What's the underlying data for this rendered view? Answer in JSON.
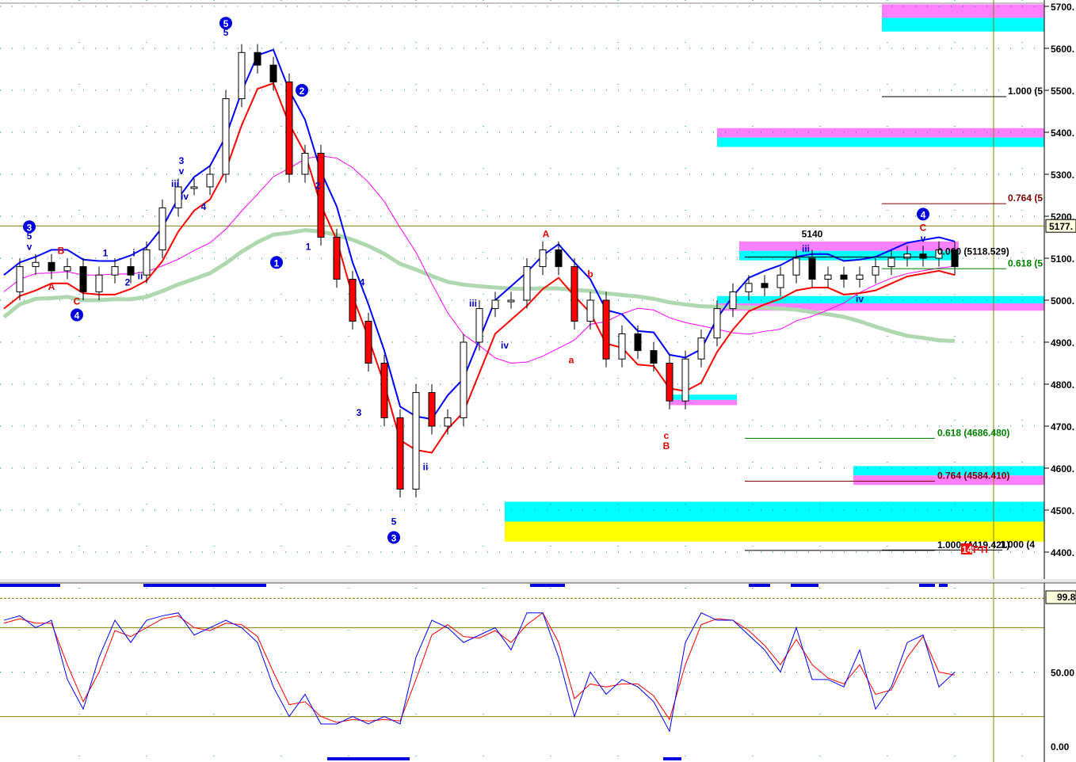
{
  "chart_data": {
    "type": "line",
    "title": "",
    "price_axis": {
      "ticks": [
        5700,
        5600,
        5500,
        5400,
        5300,
        5200,
        5100,
        5000,
        4900,
        4800,
        4700,
        4600,
        4500,
        4400
      ],
      "tick_suffix": ".",
      "ylim": [
        4380,
        5710
      ],
      "current_price_label": "5177."
    },
    "osc_axis": {
      "ticks": [
        {
          "v": 50,
          "label": "50.00"
        },
        {
          "v": 0,
          "label": "0.00"
        }
      ],
      "top_label": "99.8",
      "levels": [
        80,
        20
      ],
      "ylim": [
        0,
        100
      ]
    },
    "x": [
      0,
      1,
      2,
      3,
      4,
      5,
      6,
      7,
      8,
      9,
      10,
      11,
      12,
      13,
      14,
      15,
      16,
      17,
      18,
      19,
      20,
      21,
      22,
      23,
      24,
      25,
      26,
      27,
      28,
      29,
      30,
      31,
      32,
      33,
      34,
      35,
      36,
      37,
      38,
      39,
      40,
      41,
      42,
      43,
      44,
      45,
      46,
      47,
      48,
      49,
      50,
      51,
      52,
      53,
      54,
      55,
      56,
      57,
      58,
      59,
      60
    ],
    "series": [
      {
        "name": "price",
        "color": "#000000",
        "values": [
          5020,
          5080,
          5090,
          5070,
          5080,
          5020,
          5060,
          5080,
          5060,
          5120,
          5220,
          5270,
          5270,
          5300,
          5480,
          5590,
          5560,
          5520,
          5300,
          5350,
          5150,
          5050,
          4950,
          4850,
          4720,
          4550,
          4780,
          4700,
          4720,
          4900,
          4980,
          5000,
          5000,
          5080,
          5120,
          5080,
          4950,
          5000,
          4860,
          4920,
          4880,
          4850,
          4760,
          4860,
          4910,
          4980,
          5020,
          5040,
          5030,
          5060,
          5100,
          5050,
          5060,
          5050,
          5060,
          5080,
          5100,
          5110,
          5100,
          5120,
          5080
        ]
      },
      {
        "name": "stoch_k",
        "color": "#0000ff",
        "values": [
          85,
          88,
          80,
          85,
          45,
          25,
          60,
          85,
          70,
          85,
          88,
          90,
          75,
          80,
          85,
          80,
          70,
          40,
          20,
          35,
          15,
          15,
          20,
          15,
          20,
          15,
          60,
          85,
          80,
          70,
          75,
          80,
          65,
          90,
          90,
          60,
          20,
          50,
          35,
          45,
          40,
          30,
          10,
          70,
          90,
          85,
          85,
          75,
          65,
          50,
          80,
          45,
          45,
          40,
          65,
          25,
          40,
          70,
          75,
          40,
          50
        ]
      },
      {
        "name": "stoch_d",
        "color": "#ff0000",
        "values": [
          83,
          86,
          83,
          83,
          55,
          30,
          50,
          78,
          74,
          80,
          86,
          88,
          80,
          78,
          83,
          82,
          74,
          50,
          28,
          30,
          20,
          16,
          18,
          17,
          18,
          17,
          45,
          75,
          82,
          74,
          73,
          78,
          70,
          82,
          90,
          70,
          32,
          42,
          40,
          42,
          42,
          34,
          18,
          55,
          82,
          86,
          85,
          78,
          68,
          55,
          72,
          55,
          46,
          42,
          55,
          35,
          38,
          60,
          74,
          50,
          48
        ]
      }
    ],
    "zones": [
      {
        "name": "zone-5700",
        "low": 5640,
        "high": 5705,
        "colors": [
          "#ff80ff",
          "#00ffff"
        ]
      },
      {
        "name": "zone-5400",
        "low": 5365,
        "high": 5410,
        "colors": [
          "#ff80ff",
          "#00ffff"
        ]
      },
      {
        "name": "zone-5120",
        "low": 5095,
        "high": 5140,
        "colors": [
          "#ff80ff",
          "#00ffff"
        ]
      },
      {
        "name": "zone-5000",
        "low": 4975,
        "high": 5010,
        "colors": [
          "#00ffff",
          "#ff80ff"
        ]
      },
      {
        "name": "zone-4600",
        "low": 4560,
        "high": 4605,
        "colors": [
          "#00ffff",
          "#ff80ff"
        ]
      },
      {
        "name": "zone-4500",
        "low": 4425,
        "high": 4520,
        "colors": [
          "#00ffff",
          "#ffff00"
        ]
      },
      {
        "name": "zone-4760",
        "low": 4750,
        "high": 4775,
        "colors": [
          "#00ffff",
          "#ff80ff"
        ]
      }
    ],
    "fib_labels": [
      {
        "text": "1.000 (5",
        "price": 5500,
        "color": "#000000"
      },
      {
        "text": "0.764 (5",
        "price": 5245,
        "color": "#800000"
      },
      {
        "text": "0.000 (5118.529)",
        "price": 5118,
        "color": "#000000"
      },
      {
        "text": "0.618 (5",
        "price": 5090,
        "color": "#008000"
      },
      {
        "text": "0.618 (4686.480)",
        "price": 4686,
        "color": "#008000"
      },
      {
        "text": "0.764 (4584.410)",
        "price": 4584,
        "color": "#800000"
      },
      {
        "text": "1.000 (4419.421)",
        "price": 4419,
        "color": "#000000"
      },
      {
        "text": "1.000 (4",
        "price": 4420,
        "color": "#000000"
      }
    ],
    "wave_labels": [
      {
        "text": "5",
        "x": 14,
        "price": 5660,
        "color": "#0000c0",
        "circle": true
      },
      {
        "text": "5",
        "x": 14,
        "price": 5630,
        "color": "#0000c0"
      },
      {
        "text": "2",
        "x": 18.8,
        "price": 5500,
        "color": "#0000c0",
        "circle": true
      },
      {
        "text": "1",
        "x": 17.2,
        "price": 5090,
        "color": "#0000c0",
        "circle": true
      },
      {
        "text": "3",
        "x": 1.6,
        "price": 5175,
        "color": "#0000c0",
        "circle": true
      },
      {
        "text": "4",
        "x": 4.6,
        "price": 4965,
        "color": "#0000c0",
        "circle": true
      },
      {
        "text": "3",
        "x": 24.6,
        "price": 4435,
        "color": "#0000c0",
        "circle": true
      },
      {
        "text": "5",
        "x": 24.6,
        "price": 4465,
        "color": "#0000c0"
      },
      {
        "text": "4",
        "x": 58,
        "price": 5205,
        "color": "#0000c0",
        "circle": true
      },
      {
        "text": "A",
        "x": 3,
        "price": 5025,
        "color": "#e00000"
      },
      {
        "text": "B",
        "x": 3.6,
        "price": 5110,
        "color": "#e00000"
      },
      {
        "text": "C",
        "x": 4.6,
        "price": 4990,
        "color": "#e00000"
      },
      {
        "text": "A",
        "x": 34.2,
        "price": 5150,
        "color": "#e00000"
      },
      {
        "text": "a",
        "x": 35.8,
        "price": 4850,
        "color": "#e00000"
      },
      {
        "text": "b",
        "x": 37,
        "price": 5055,
        "color": "#e00000"
      },
      {
        "text": "c",
        "x": 41.8,
        "price": 4670,
        "color": "#e00000"
      },
      {
        "text": "B",
        "x": 41.8,
        "price": 4645,
        "color": "#e00000"
      },
      {
        "text": "C",
        "x": 58,
        "price": 5165,
        "color": "#e00000"
      },
      {
        "text": "v",
        "x": 58,
        "price": 5140,
        "color": "#0000c0"
      },
      {
        "text": "iii",
        "x": 29.6,
        "price": 4985,
        "color": "#0000c0"
      },
      {
        "text": "iv",
        "x": 31.6,
        "price": 4885,
        "color": "#0000c0"
      },
      {
        "text": "ii",
        "x": 26.6,
        "price": 4595,
        "color": "#0000c0"
      },
      {
        "text": "4",
        "x": 22.6,
        "price": 5035,
        "color": "#0000c0"
      },
      {
        "text": "3",
        "x": 22.4,
        "price": 4725,
        "color": "#0000c0"
      },
      {
        "text": "2",
        "x": 19.8,
        "price": 5265,
        "color": "#0000c0"
      },
      {
        "text": "1",
        "x": 19.2,
        "price": 5120,
        "color": "#0000c0"
      },
      {
        "text": "3",
        "x": 11.2,
        "price": 5325,
        "color": "#0000c0"
      },
      {
        "text": "v",
        "x": 11.2,
        "price": 5300,
        "color": "#0000c0"
      },
      {
        "text": "iii",
        "x": 10.8,
        "price": 5270,
        "color": "#0000c0"
      },
      {
        "text": "iv",
        "x": 11.4,
        "price": 5240,
        "color": "#0000c0"
      },
      {
        "text": "4",
        "x": 12.6,
        "price": 5215,
        "color": "#0000c0"
      },
      {
        "text": "1",
        "x": 6.4,
        "price": 5105,
        "color": "#0000c0"
      },
      {
        "text": "i",
        "x": 8.2,
        "price": 5105,
        "color": "#0000c0"
      },
      {
        "text": "2",
        "x": 7.8,
        "price": 5035,
        "color": "#0000c0"
      },
      {
        "text": "ii",
        "x": 8.6,
        "price": 5050,
        "color": "#0000c0"
      },
      {
        "text": "5",
        "x": 1.6,
        "price": 5145,
        "color": "#0000c0"
      },
      {
        "text": "v",
        "x": 1.6,
        "price": 5120,
        "color": "#0000c0"
      },
      {
        "text": "iii",
        "x": 50.6,
        "price": 5115,
        "color": "#0000c0"
      },
      {
        "text": "iv",
        "x": 54,
        "price": 4995,
        "color": "#0000c0"
      },
      {
        "text": "5140",
        "x": 51,
        "price": 5150,
        "color": "#000000"
      }
    ],
    "badge": {
      "number": "14",
      "text": "PTI"
    }
  }
}
